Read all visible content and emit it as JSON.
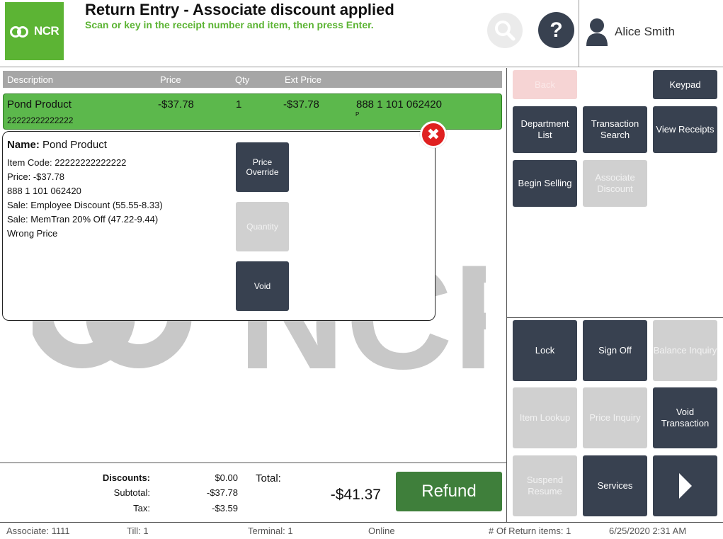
{
  "header": {
    "title": "Return Entry - Associate discount applied",
    "subtitle": "Scan or key in the receipt number and item, then press Enter.",
    "logo_text": "NCR",
    "help_symbol": "?",
    "user_name": "Alice Smith",
    "search_icon": "magnifier-icon",
    "user_icon": "person-icon"
  },
  "table": {
    "columns": [
      "Description",
      "Price",
      "Qty",
      "Ext Price"
    ],
    "rows": [
      {
        "description": "Pond Product",
        "price": "-$37.78",
        "qty": "1",
        "ext_price": "-$37.78",
        "code_display": "888 1 101 062420",
        "item_code": "22222222222222",
        "flag": "P"
      }
    ]
  },
  "details": {
    "name_label": "Name:",
    "name_value": "Pond Product",
    "lines": [
      "Item Code: 22222222222222",
      "Price: -$37.78",
      "888 1 101 062420",
      "Sale: Employee Discount (55.55-8.33)",
      "Sale: MemTran 20% Off (47.22-9.44)",
      "Wrong Price"
    ],
    "buttons": {
      "price_override": "Price Override",
      "quantity": "Quantity",
      "void": "Void"
    },
    "close_symbol": "✖"
  },
  "right_top": {
    "back": "Back",
    "keypad": "Keypad",
    "department_list": "Department List",
    "transaction_search": "Transaction Search",
    "view_receipts": "View Receipts",
    "begin_selling": "Begin Selling",
    "associate_discount": "Associate Discount"
  },
  "right_bottom": {
    "lock": "Lock",
    "sign_off": "Sign Off",
    "balance_inquiry": "Balance Inquiry",
    "item_lookup": "Item Lookup",
    "price_inquiry": "Price Inquiry",
    "void_transaction": "Void Transaction",
    "suspend_resume": "Suspend Resume",
    "services": "Services",
    "next_icon": "chevron-right-icon"
  },
  "totals": {
    "discounts_label": "Discounts:",
    "discounts_value": "$0.00",
    "subtotal_label": "Subtotal:",
    "subtotal_value": "-$37.78",
    "tax_label": "Tax:",
    "tax_value": "-$3.59",
    "total_label": "Total:",
    "total_value": "-$41.37",
    "refund_label": "Refund"
  },
  "status_bar": {
    "associate": "Associate: 1111",
    "till": "Till: 1",
    "terminal": "Terminal: 1",
    "online": "Online",
    "return_items": "# Of Return items: 1",
    "datetime": "6/25/2020 2:31 AM"
  },
  "colors": {
    "accent_green": "#5cb434",
    "dark_button": "#384150",
    "refund_green": "#3f7f3b",
    "close_red": "#e02020"
  }
}
